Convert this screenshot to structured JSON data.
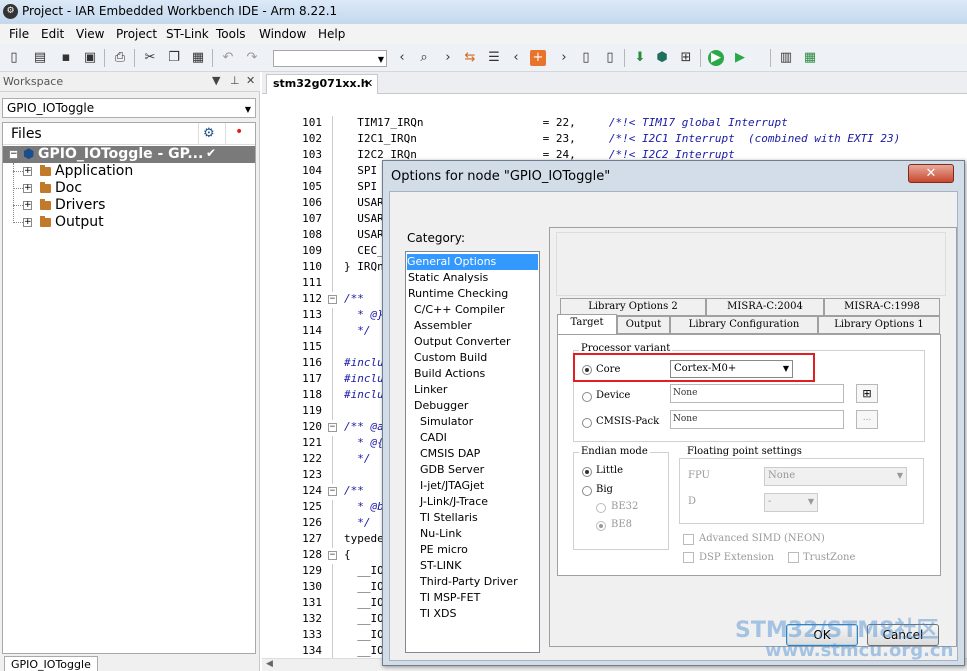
{
  "window": {
    "title": "Project - IAR Embedded Workbench IDE - Arm 8.22.1"
  },
  "menu": [
    "File",
    "Edit",
    "View",
    "Project",
    "ST-Link",
    "Tools",
    "Window",
    "Help"
  ],
  "workspace": {
    "header": "Workspace",
    "configuration": "GPIO_IOToggle",
    "files_label": "Files",
    "tree": [
      {
        "label": "GPIO_IOToggle - GP...",
        "type": "project",
        "selected": true,
        "checked": true
      },
      {
        "label": "Application",
        "type": "folder"
      },
      {
        "label": "Doc",
        "type": "folder"
      },
      {
        "label": "Drivers",
        "type": "folder"
      },
      {
        "label": "Output",
        "type": "folder"
      }
    ],
    "bottom_tab": "GPIO_IOToggle"
  },
  "editor": {
    "tab_label": "stm32g071xx.h",
    "lines": [
      {
        "n": "101",
        "text": "  TIM17_IRQn                  = 22,     ",
        "cmt": "/*!< TIM17 global Interrupt"
      },
      {
        "n": "102",
        "text": "  I2C1_IRQn                   = 23,     ",
        "cmt": "/*!< I2C1 Interrupt  (combined with EXTI 23)"
      },
      {
        "n": "103",
        "text": "  I2C2_IRQn                   = 24,     ",
        "cmt": "/*!< I2C2 Interrupt"
      },
      {
        "n": "104",
        "text": "  SPI",
        "cmt": ""
      },
      {
        "n": "105",
        "text": "  SPI",
        "cmt": ""
      },
      {
        "n": "106",
        "text": "  USAR",
        "cmt": ""
      },
      {
        "n": "107",
        "text": "  USAR",
        "cmt": ""
      },
      {
        "n": "108",
        "text": "  USAR",
        "cmt": ""
      },
      {
        "n": "109",
        "text": "  CEC_",
        "cmt": ""
      },
      {
        "n": "110",
        "text": "} IRQn",
        "cmt": ""
      },
      {
        "n": "111",
        "text": "",
        "cmt": ""
      },
      {
        "n": "112",
        "text": "",
        "cmt": "/**",
        "fold": true
      },
      {
        "n": "113",
        "text": "",
        "cmt": "  * @}"
      },
      {
        "n": "114",
        "text": "",
        "cmt": "  */"
      },
      {
        "n": "115",
        "text": "",
        "cmt": ""
      },
      {
        "n": "116",
        "text": "",
        "cmt": "#inclu"
      },
      {
        "n": "117",
        "text": "",
        "cmt": "#inclu"
      },
      {
        "n": "118",
        "text": "",
        "cmt": "#inclu"
      },
      {
        "n": "119",
        "text": "",
        "cmt": ""
      },
      {
        "n": "120",
        "text": "",
        "cmt": "/** @a",
        "fold": true
      },
      {
        "n": "121",
        "text": "",
        "cmt": "  * @{"
      },
      {
        "n": "122",
        "text": "",
        "cmt": "  */"
      },
      {
        "n": "123",
        "text": "",
        "cmt": ""
      },
      {
        "n": "124",
        "text": "",
        "cmt": "/**",
        "fold": true
      },
      {
        "n": "125",
        "text": "",
        "cmt": "  * @b"
      },
      {
        "n": "126",
        "text": "",
        "cmt": "  */"
      },
      {
        "n": "127",
        "text": "typede",
        "cmt": ""
      },
      {
        "n": "128",
        "text": "{",
        "cmt": "",
        "fold": true
      },
      {
        "n": "129",
        "text": "  __IO",
        "cmt": ""
      },
      {
        "n": "130",
        "text": "  __IO",
        "cmt": ""
      },
      {
        "n": "131",
        "text": "  __IO",
        "cmt": ""
      },
      {
        "n": "132",
        "text": "  __IO",
        "cmt": ""
      },
      {
        "n": "133",
        "text": "  __IO",
        "cmt": ""
      },
      {
        "n": "134",
        "text": "  __IO",
        "cmt": ""
      }
    ]
  },
  "dialog": {
    "title": "Options for node \"GPIO_IOToggle\"",
    "close": "✕",
    "category_label": "Category:",
    "categories": [
      {
        "label": "General Options",
        "indent": 0,
        "selected": true
      },
      {
        "label": "Static Analysis",
        "indent": 0
      },
      {
        "label": "Runtime Checking",
        "indent": 0
      },
      {
        "label": "C/C++ Compiler",
        "indent": 1
      },
      {
        "label": "Assembler",
        "indent": 1
      },
      {
        "label": "Output Converter",
        "indent": 1
      },
      {
        "label": "Custom Build",
        "indent": 1
      },
      {
        "label": "Build Actions",
        "indent": 1
      },
      {
        "label": "Linker",
        "indent": 1
      },
      {
        "label": "Debugger",
        "indent": 1
      },
      {
        "label": "Simulator",
        "indent": 2
      },
      {
        "label": "CADI",
        "indent": 2
      },
      {
        "label": "CMSIS DAP",
        "indent": 2
      },
      {
        "label": "GDB Server",
        "indent": 2
      },
      {
        "label": "I-jet/JTAGjet",
        "indent": 2
      },
      {
        "label": "J-Link/J-Trace",
        "indent": 2
      },
      {
        "label": "TI Stellaris",
        "indent": 2
      },
      {
        "label": "Nu-Link",
        "indent": 2
      },
      {
        "label": "PE micro",
        "indent": 2
      },
      {
        "label": "ST-LINK",
        "indent": 2
      },
      {
        "label": "Third-Party Driver",
        "indent": 2
      },
      {
        "label": "TI MSP-FET",
        "indent": 2
      },
      {
        "label": "TI XDS",
        "indent": 2
      }
    ],
    "tabs_back": [
      "Library Options 2",
      "MISRA-C:2004",
      "MISRA-C:1998"
    ],
    "tabs_front": [
      "Target",
      "Output",
      "Library Configuration",
      "Library Options 1"
    ],
    "processor_variant": {
      "title": "Processor variant",
      "core_label": "Core",
      "core_value": "Cortex-M0+",
      "device_label": "Device",
      "device_value": "None",
      "cmsis_label": "CMSIS-Pack",
      "cmsis_value": "None",
      "dots": "..."
    },
    "endian": {
      "title": "Endian mode",
      "little": "Little",
      "big": "Big",
      "be32": "BE32",
      "be8": "BE8"
    },
    "fp": {
      "title": "Floating point settings",
      "fpu_label": "FPU",
      "fpu_value": "None",
      "d_label": "D",
      "d_value": "-"
    },
    "checks": {
      "simd": "Advanced SIMD (NEON)",
      "dsp": "DSP Extension",
      "trustzone": "TrustZone"
    },
    "ok": "OK",
    "cancel": "Cancel"
  },
  "watermark": {
    "line1": "STM32/STM8社区",
    "line2": "www.stmcu.org.cn"
  }
}
